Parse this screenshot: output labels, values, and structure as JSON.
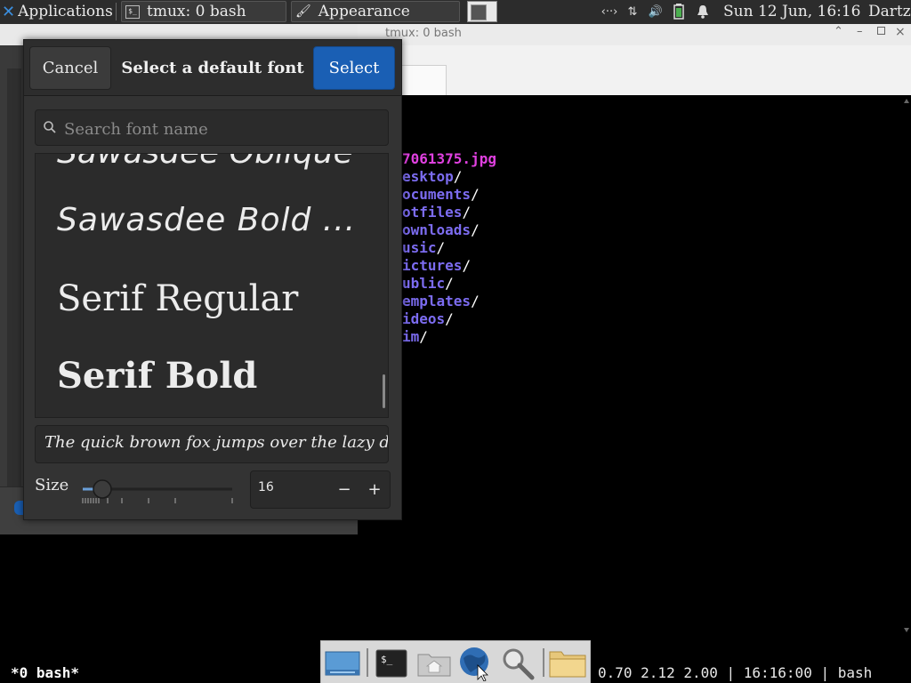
{
  "top_panel": {
    "applications_label": "Applications",
    "tasks": [
      {
        "label": "tmux: 0 bash"
      },
      {
        "label": "Appearance"
      }
    ],
    "clock": "Sun 12 Jun, 16:16",
    "user": "Dartz"
  },
  "terminal": {
    "title": "tmux: 0 bash",
    "files": [
      {
        "name": "7061375.jpg",
        "suffix": "",
        "color": "#e040e0"
      },
      {
        "name": "esktop",
        "suffix": "/",
        "color": "#7c6cf0"
      },
      {
        "name": "ocuments",
        "suffix": "/",
        "color": "#7c6cf0"
      },
      {
        "name": "otfiles",
        "suffix": "/",
        "color": "#7c6cf0"
      },
      {
        "name": "ownloads",
        "suffix": "/",
        "color": "#7c6cf0"
      },
      {
        "name": "usic",
        "suffix": "/",
        "color": "#7c6cf0"
      },
      {
        "name": "ictures",
        "suffix": "/",
        "color": "#7c6cf0"
      },
      {
        "name": "ublic",
        "suffix": "/",
        "color": "#7c6cf0"
      },
      {
        "name": "emplates",
        "suffix": "/",
        "color": "#7c6cf0"
      },
      {
        "name": "ideos",
        "suffix": "/",
        "color": "#7c6cf0"
      },
      {
        "name": "im",
        "suffix": "/",
        "color": "#7c6cf0"
      }
    ]
  },
  "tmux_status": {
    "left": "*0 bash*",
    "right": "0.70 2.12 2.00 | 16:16:00 | bash"
  },
  "dock": {
    "items": [
      "desktop-icon",
      "terminal-icon",
      "home-folder-icon",
      "browser-icon",
      "search-icon",
      "folder-icon"
    ]
  },
  "font_dialog": {
    "cancel_label": "Cancel",
    "title": "Select a default font",
    "select_label": "Select",
    "search_placeholder": "Search font name",
    "fonts": [
      {
        "name": "Sawasdee Oblique"
      },
      {
        "name": "Sawasdee Bold ..."
      },
      {
        "name": "Serif Regular"
      },
      {
        "name": "Serif Bold"
      }
    ],
    "preview_text": "The quick brown fox jumps over the lazy d",
    "size_label": "Size",
    "size_value": "16",
    "minus_label": "−",
    "plus_label": "+"
  },
  "colors": {
    "accent": "#1a5fb4",
    "dialog_bg": "#333333",
    "panel_bg": "#2c2c2c"
  }
}
